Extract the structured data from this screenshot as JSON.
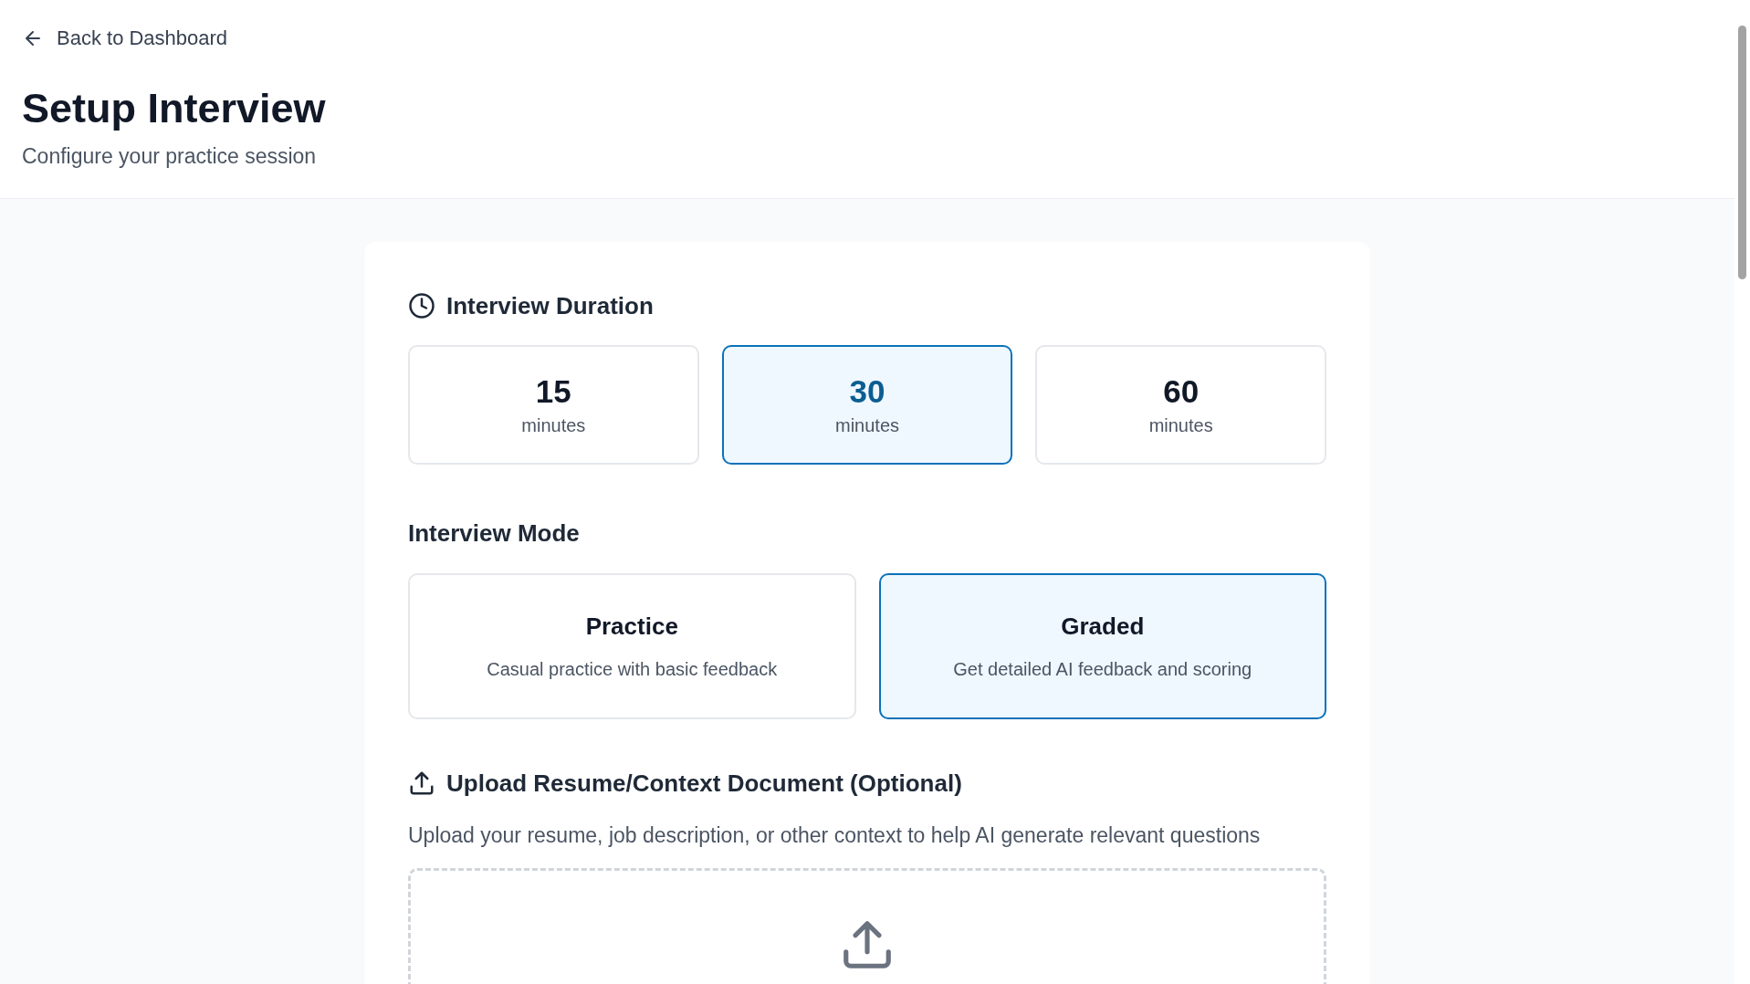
{
  "back_link": {
    "label": "Back to Dashboard"
  },
  "header": {
    "title": "Setup Interview",
    "subtitle": "Configure your practice session"
  },
  "duration": {
    "heading": "Interview Duration",
    "options": [
      {
        "value": "15",
        "unit": "minutes",
        "selected": false
      },
      {
        "value": "30",
        "unit": "minutes",
        "selected": true
      },
      {
        "value": "60",
        "unit": "minutes",
        "selected": false
      }
    ]
  },
  "mode": {
    "heading": "Interview Mode",
    "options": [
      {
        "title": "Practice",
        "description": "Casual practice with basic feedback",
        "selected": false
      },
      {
        "title": "Graded",
        "description": "Get detailed AI feedback and scoring",
        "selected": true
      }
    ]
  },
  "upload": {
    "heading": "Upload Resume/Context Document (Optional)",
    "description": "Upload your resume, job description, or other context to help AI generate relevant questions"
  }
}
